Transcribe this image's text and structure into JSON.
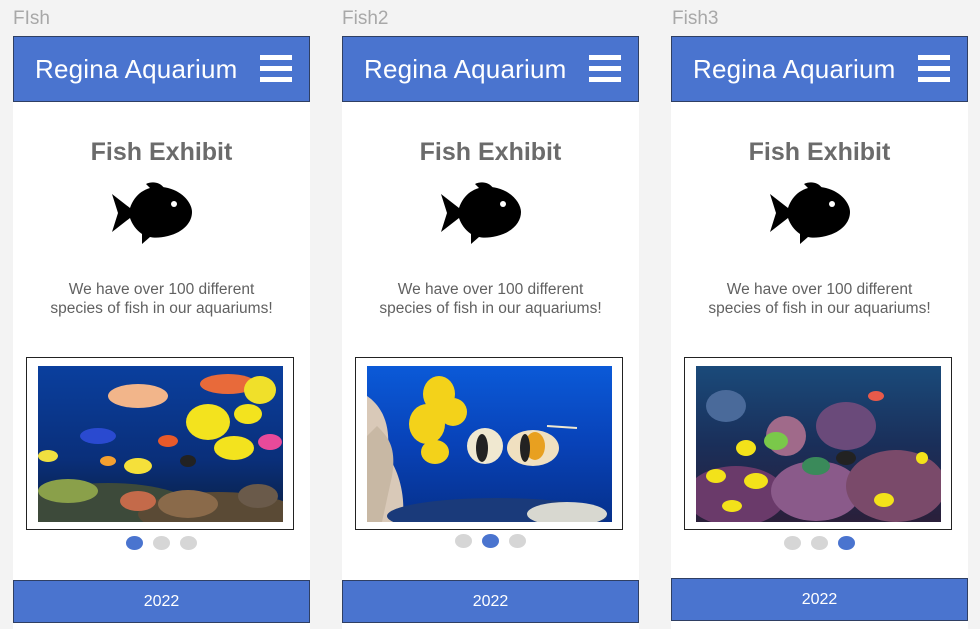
{
  "frames": [
    {
      "label": "FIsh",
      "header": {
        "title": "Regina Aquarium",
        "menu_icon": "hamburger-menu-icon"
      },
      "exhibit_title": "Fish Exhibit",
      "fish_icon": "fish-icon",
      "description_line1": "We have over 100 different",
      "description_line2": "species of fish in our aquariums!",
      "carousel": {
        "active_index": 0,
        "dot_count": 3
      },
      "footer": "2022"
    },
    {
      "label": "Fish2",
      "header": {
        "title": "Regina Aquarium",
        "menu_icon": "hamburger-menu-icon"
      },
      "exhibit_title": "Fish Exhibit",
      "fish_icon": "fish-icon",
      "description_line1": "We have over 100 different",
      "description_line2": "species of fish in our aquariums!",
      "carousel": {
        "active_index": 1,
        "dot_count": 3
      },
      "footer": "2022"
    },
    {
      "label": "Fish3",
      "header": {
        "title": "Regina Aquarium",
        "menu_icon": "hamburger-menu-icon"
      },
      "exhibit_title": "Fish Exhibit",
      "fish_icon": "fish-icon",
      "description_line1": "We have over 100 different",
      "description_line2": "species of fish in our aquariums!",
      "carousel": {
        "active_index": 2,
        "dot_count": 3
      },
      "footer": "2022"
    }
  ],
  "colors": {
    "accent": "#4a74cf",
    "inactive_dot": "#d6d6d6",
    "heading_text": "#6b6b6b"
  }
}
